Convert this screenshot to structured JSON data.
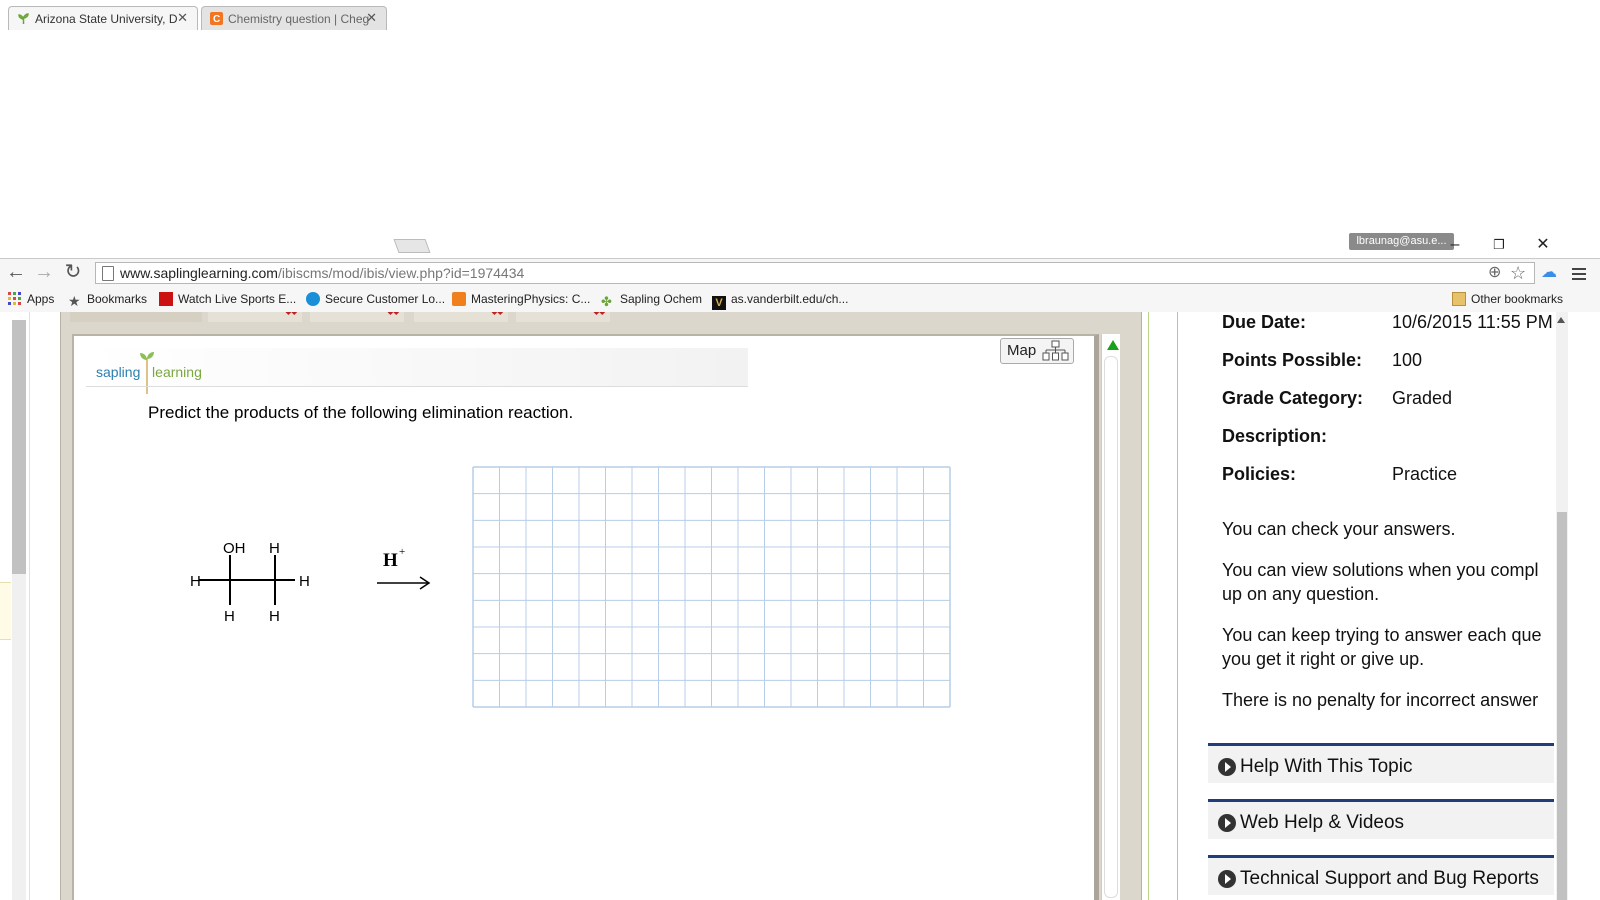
{
  "browser": {
    "tabs": [
      {
        "title": "Arizona State University, D",
        "active": true
      },
      {
        "title": "Chemistry question | Cheg",
        "active": false
      }
    ],
    "profile": "lbraunag@asu.e...",
    "url_host": "www.saplinglearning.com",
    "url_path": "/ibiscms/mod/ibis/view.php?id=1974434",
    "bookmarks": [
      {
        "label": "Apps",
        "icon": "apps-grid-icon"
      },
      {
        "label": "Bookmarks",
        "icon": "star-icon"
      },
      {
        "label": "Watch Live Sports E...",
        "icon": "watch-icon"
      },
      {
        "label": "Secure Customer Lo...",
        "icon": "cloud-icon"
      },
      {
        "label": "MasteringPhysics: C...",
        "icon": "mastering-icon"
      },
      {
        "label": "Sapling Ochem",
        "icon": "sapling-icon"
      },
      {
        "label": "as.vanderbilt.edu/ch...",
        "icon": "vanderbilt-icon"
      }
    ],
    "other_bookmarks": "Other bookmarks"
  },
  "question": {
    "logo_part1": "sapling",
    "logo_part2": "learning",
    "map_label": "Map",
    "prompt": "Predict the products of the following elimination reaction.",
    "reagent": "H",
    "reagent_charge": "+",
    "molecule_labels": {
      "oh": "OH",
      "h": "H"
    }
  },
  "assignment": {
    "due_date_label": "Due Date:",
    "due_date": "10/6/2015 11:55 PM",
    "points_label": "Points Possible:",
    "points": "100",
    "grade_category_label": "Grade Category:",
    "grade_category": "Graded",
    "description_label": "Description:",
    "policies_label": "Policies:",
    "policies": "Practice",
    "policy_lines": [
      [
        "You can check your answers."
      ],
      [
        "You can view solutions when you compl",
        "up on any question."
      ],
      [
        "You can keep trying to answer each que",
        "you get it right or give up."
      ],
      [
        "There is no penalty for incorrect answer"
      ]
    ],
    "help_sections": [
      "Help With This Topic",
      "Web Help & Videos",
      "Technical Support and Bug Reports"
    ]
  },
  "colors": {
    "accent_blue": "#1f3d7a",
    "grid_line": "#b8cde8",
    "sapling_green": "#79a83e"
  }
}
